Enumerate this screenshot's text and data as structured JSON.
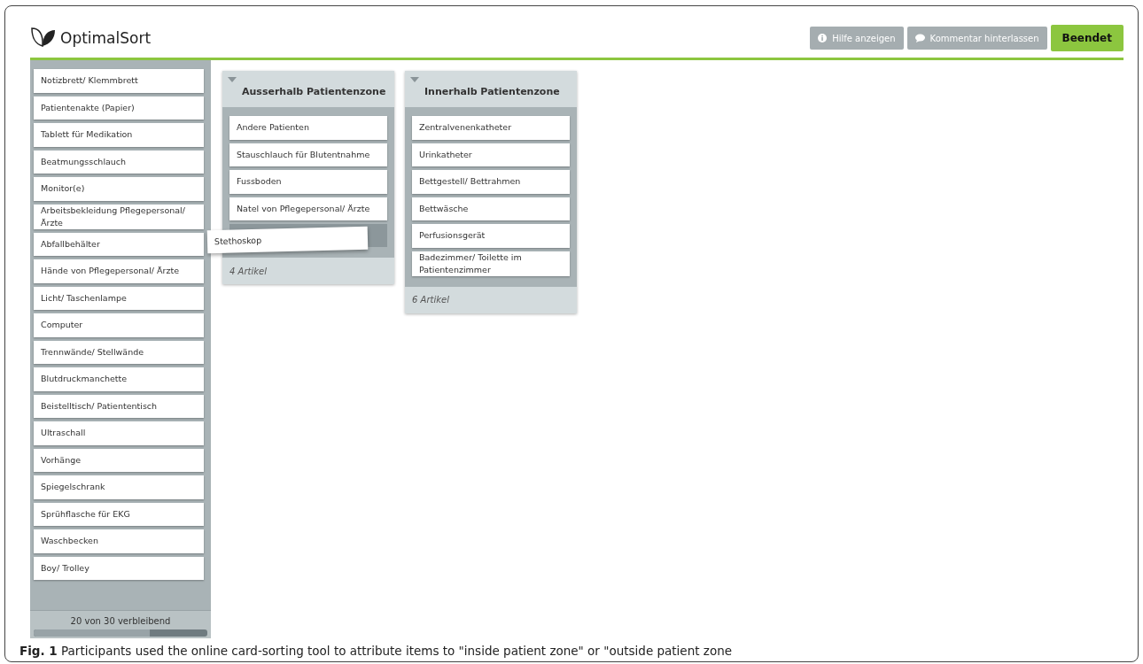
{
  "header": {
    "logo": "OptimalSort",
    "buttons": [
      {
        "kind": "help",
        "label": "Hilfe anzeigen"
      },
      {
        "kind": "comment",
        "label": "Kommentar hinterlassen"
      },
      {
        "kind": "finish",
        "label": "Beendet"
      }
    ]
  },
  "sidebar": {
    "cards": [
      "Notizbrett/ Klemmbrett",
      "Patientenakte (Papier)",
      "Tablett für Medikation",
      "Beatmungsschlauch",
      "Monitor(e)",
      "Arbeitsbekleidung Pflegepersonal/ Ärzte",
      "Abfallbehälter",
      "Hände von Pflegepersonal/ Ärzte",
      "Licht/ Taschenlampe",
      "Computer",
      "Trennwände/ Stellwände",
      "Blutdruckmanchette",
      "Beistelltisch/ Patiententisch",
      "Ultraschall",
      "Vorhänge",
      "Spiegelschrank",
      "Sprühflasche für EKG",
      "Waschbecken",
      "Boy/ Trolley"
    ],
    "remaining": "20 von 30 verbleibend",
    "progress": {
      "level": 0.67
    }
  },
  "groups": [
    {
      "title": "Ausserhalb Patientenzone",
      "cards": [
        "Andere Patienten",
        "Stauschlauch für Blutentnahme",
        "Fussboden",
        "Natel von Pflegepersonal/ Ärzte"
      ],
      "drop_slot": true,
      "count": "4 Artikel"
    },
    {
      "title": "Innerhalb Patientenzone",
      "cards": [
        "Zentralvenenkatheter",
        "Urinkatheter",
        "Bettgestell/ Bettrahmen",
        "Bettwäsche",
        "Perfusionsgerät",
        "Badezimmer/ Toilette im Patientenzimmer"
      ],
      "drop_slot": false,
      "count": "6 Artikel"
    }
  ],
  "dragged_card": "Stethoskop",
  "caption": "**Fig. 1** Participants used the online card-sorting tool to attribute items to \"inside patient zone\" or \"outside patient zone"
}
